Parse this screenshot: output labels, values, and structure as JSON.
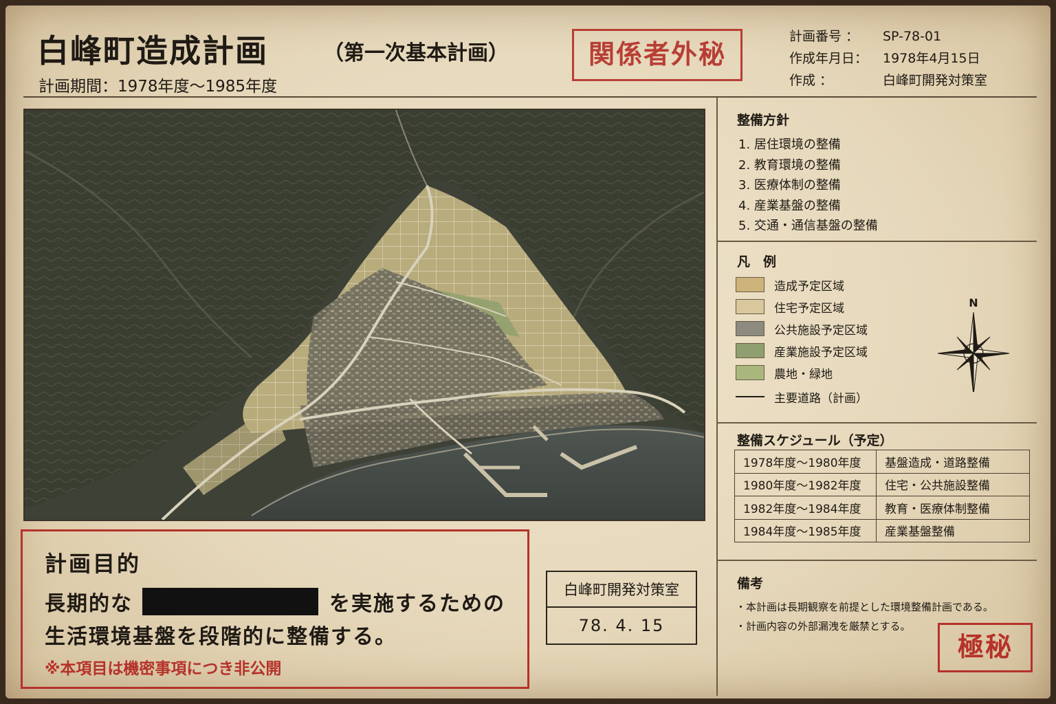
{
  "header": {
    "title": "白峰町造成計画",
    "subtitle": "（第一次基本計画）",
    "period": "計画期間：1978年度〜1985年度",
    "stamp": "関係者外秘"
  },
  "meta": [
    {
      "label": "計画番号 ：",
      "value": "SP-78-01"
    },
    {
      "label": "作成年月日：",
      "value": "1978年4月15日"
    },
    {
      "label": "作成 ：",
      "value": "白峰町開発対策室"
    }
  ],
  "policy": {
    "heading": "整備方針",
    "items": [
      "1. 居住環境の整備",
      "2. 教育環境の整備",
      "3. 医療体制の整備",
      "4. 産業基盤の整備",
      "5. 交通・通信基盤の整備"
    ]
  },
  "legend": {
    "heading": "凡　例",
    "items": [
      {
        "label": "造成予定区域",
        "color": "#cdb37a"
      },
      {
        "label": "住宅予定区域",
        "color": "#d9c79e"
      },
      {
        "label": "公共施設予定区域",
        "color": "#8d8a80"
      },
      {
        "label": "産業施設予定区域",
        "color": "#8f9f6f"
      },
      {
        "label": "農地・緑地",
        "color": "#a9b77d"
      },
      {
        "label": "主要道路（計画）",
        "color": "#1f1a14"
      }
    ],
    "compass_label": "N"
  },
  "schedule": {
    "heading": "整備スケジュール（予定）",
    "rows": [
      {
        "period": "1978年度〜1980年度",
        "task": "基盤造成・道路整備"
      },
      {
        "period": "1980年度〜1982年度",
        "task": "住宅・公共施設整備"
      },
      {
        "period": "1982年度〜1984年度",
        "task": "教育・医療体制整備"
      },
      {
        "period": "1984年度〜1985年度",
        "task": "産業基盤整備"
      }
    ]
  },
  "notes": {
    "heading": "備考",
    "items": [
      "・本計画は長期観察を前提とした環境整備計画である。",
      "・計画内容の外部漏洩を厳禁とする。"
    ],
    "stamp": "極秘"
  },
  "purpose": {
    "title": "計画目的",
    "line1_before": "長期的な",
    "line1_after": "を実施するための",
    "line2": "生活環境基盤を段階的に整備する。",
    "note": "※本項目は機密事項につき非公開"
  },
  "dept": {
    "name": "白峰町開発対策室",
    "date": "78. 4. 15"
  },
  "colors": {
    "stamp_red": "#b5322a",
    "paper": "#e9dcc0",
    "ink": "#1f1a14"
  }
}
